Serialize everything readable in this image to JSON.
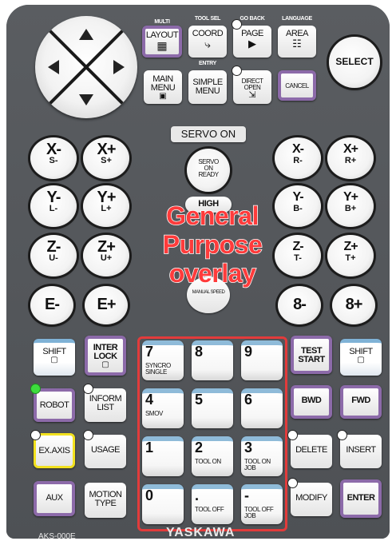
{
  "title_cut": "...",
  "dpad": {
    "up": "▲",
    "down": "▼",
    "left": "◀",
    "right": "▶"
  },
  "top_keys": {
    "layout": {
      "tag": "MULTI",
      "label": "LAYOUT",
      "icon": "▦"
    },
    "coord": {
      "tag": "TOOL SEL",
      "label": "COORD",
      "icon": "⤷"
    },
    "page": {
      "tag": "GO BACK",
      "label": "PAGE",
      "icon": "▶"
    },
    "area": {
      "tag": "LANGUAGE",
      "label": "AREA",
      "icon": "☷"
    },
    "select": "SELECT",
    "main_menu": {
      "label1": "MAIN",
      "label2": "MENU",
      "icon": "▣"
    },
    "simple_menu": {
      "tag": "ENTRY",
      "label1": "SIMPLE",
      "label2": "MENU"
    },
    "direct_open": {
      "label1": "DIRECT",
      "label2": "OPEN",
      "icon": "⇲"
    },
    "cancel": "CANCEL"
  },
  "servo": {
    "label": "SERVO ON",
    "ready1": "SERVO",
    "ready2": "ON",
    "ready3": "READY",
    "high": "HIGH",
    "manual_speed": "MANUAL SPEED"
  },
  "axes_left": [
    {
      "main": "X-",
      "sub": "S-"
    },
    {
      "main": "X+",
      "sub": "S+"
    },
    {
      "main": "Y-",
      "sub": "L-"
    },
    {
      "main": "Y+",
      "sub": "L+"
    },
    {
      "main": "Z-",
      "sub": "U-"
    },
    {
      "main": "Z+",
      "sub": "U+"
    },
    {
      "main": "E-",
      "sub": ""
    },
    {
      "main": "E+",
      "sub": ""
    }
  ],
  "axes_right": [
    {
      "main": "X-",
      "sub": "R-"
    },
    {
      "main": "X+",
      "sub": "R+"
    },
    {
      "main": "Y-",
      "sub": "B-"
    },
    {
      "main": "Y+",
      "sub": "B+"
    },
    {
      "main": "Z-",
      "sub": "T-"
    },
    {
      "main": "Z+",
      "sub": "T+"
    },
    {
      "main": "8-",
      "sub": ""
    },
    {
      "main": "8+",
      "sub": ""
    }
  ],
  "overlay": {
    "line1": "General",
    "line2": "Purpose",
    "line3": "overlay"
  },
  "left_keys": {
    "shift": "SHIFT",
    "interlock1": "INTER",
    "interlock2": "LOCK",
    "robot": "ROBOT",
    "inform1": "INFORM",
    "inform2": "LIST",
    "exaxis": "EX.AXIS",
    "usage": "USAGE",
    "aux": "AUX",
    "motion1": "MOTION",
    "motion2": "TYPE"
  },
  "right_keys": {
    "test1": "TEST",
    "test2": "START",
    "shift": "SHIFT",
    "bwd": "BWD",
    "fwd": "FWD",
    "delete": "DELETE",
    "insert": "INSERT",
    "modify": "MODIFY",
    "enter": "ENTER"
  },
  "numpad": [
    {
      "digit": "7",
      "sub": "SYNCRO SINGLE"
    },
    {
      "digit": "8",
      "sub": ""
    },
    {
      "digit": "9",
      "sub": ""
    },
    {
      "digit": "4",
      "sub": "SMOV"
    },
    {
      "digit": "5",
      "sub": ""
    },
    {
      "digit": "6",
      "sub": ""
    },
    {
      "digit": "1",
      "sub": ""
    },
    {
      "digit": "2",
      "sub": "TOOL ON"
    },
    {
      "digit": "3",
      "sub": "TOOL ON JOB"
    },
    {
      "digit": "0",
      "sub": ""
    },
    {
      "digit": ".",
      "sub": "TOOL OFF"
    },
    {
      "digit": "-",
      "sub": "TOOL OFF JOB"
    }
  ],
  "footer": {
    "model": "AKS-000E",
    "brand": "YASKAWA"
  }
}
